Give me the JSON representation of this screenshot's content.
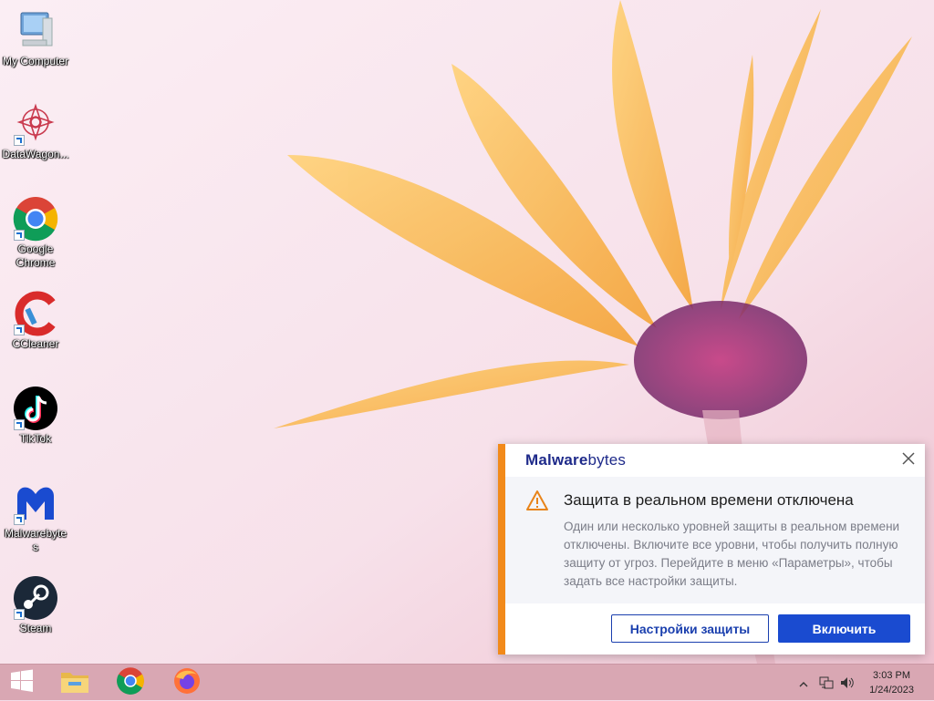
{
  "desktop": {
    "icons": [
      {
        "label": "My Computer",
        "icon": "computer-icon"
      },
      {
        "label": "DataWagon...",
        "icon": "datawagon-icon"
      },
      {
        "label": "Google Chrome",
        "icon": "chrome-icon"
      },
      {
        "label": "CCleaner",
        "icon": "ccleaner-icon"
      },
      {
        "label": "TikTok",
        "icon": "tiktok-icon"
      },
      {
        "label": "Malwarebytes",
        "icon": "malwarebytes-icon"
      },
      {
        "label": "Steam",
        "icon": "steam-icon"
      }
    ]
  },
  "notification": {
    "brand_prefix": "Malware",
    "brand_suffix": "bytes",
    "title": "Защита в реальном времени отключена",
    "message": "Один или несколько уровней защиты в реальном времени отключены. Включите все уровни, чтобы получить полную защиту от угроз. Перейдите в меню «Параметры», чтобы задать все настройки защиты.",
    "secondary_button": "Настройки защиты",
    "primary_button": "Включить",
    "accent_color": "#f28a1a",
    "brand_color": "#1e2a8a",
    "primary_button_color": "#1a4bd0"
  },
  "taskbar": {
    "pinned": [
      "start-icon",
      "file-explorer-icon",
      "chrome-icon",
      "firefox-icon"
    ],
    "tray": [
      "show-hidden-icons-chevron",
      "network-icon",
      "volume-icon"
    ],
    "time": "3:03 PM",
    "date": "1/24/2023"
  }
}
